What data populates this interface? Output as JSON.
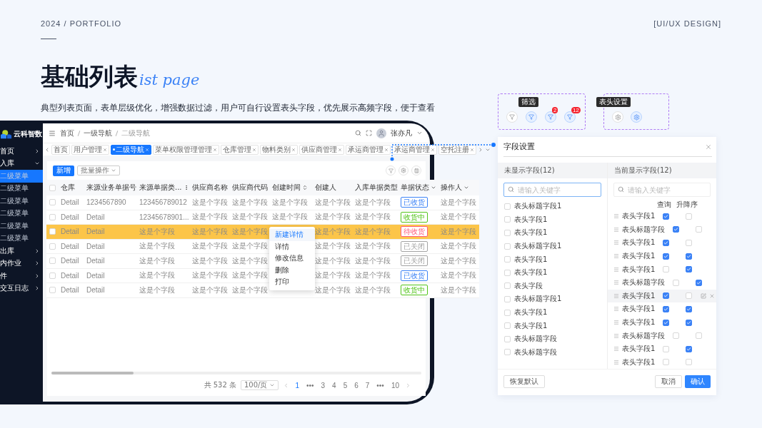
{
  "header": {
    "portfolio": "2024 / PORTFOLIO",
    "category": "[UI/UX DESIGN]"
  },
  "title": {
    "main": "基础列表",
    "script": "ist page"
  },
  "description": "典型列表页面，表单层级优化，增强数据过滤，用户可自行设置表头字段，优先展示高频字段，便于查看",
  "app": {
    "logo": "云科智数",
    "sidebar": [
      {
        "label": "首页",
        "expanded": false
      },
      {
        "label": "入库",
        "expanded": true,
        "children": [
          {
            "label": "二级菜单",
            "selected": true
          },
          {
            "label": "二级菜单",
            "selected": false
          },
          {
            "label": "二级菜单",
            "selected": false
          },
          {
            "label": "二级菜单",
            "selected": false
          },
          {
            "label": "二级菜单",
            "selected": false
          },
          {
            "label": "二级菜单",
            "selected": false
          }
        ]
      },
      {
        "label": "出库",
        "expanded": false
      },
      {
        "label": "内作业",
        "expanded": false
      },
      {
        "label": "件",
        "expanded": false
      },
      {
        "label": "交互日志",
        "expanded": false
      }
    ],
    "breadcrumb": [
      "首页",
      "一级导航",
      "二级导航"
    ],
    "user": {
      "name": "张亦凡"
    },
    "tabs": [
      {
        "label": "首页",
        "closable": false,
        "selected": false
      },
      {
        "label": "用户管理",
        "closable": true,
        "selected": false
      },
      {
        "label": "二级导航",
        "closable": true,
        "selected": true
      },
      {
        "label": "菜单权限管理管理",
        "closable": true,
        "selected": false
      },
      {
        "label": "仓库管理",
        "closable": true,
        "selected": false
      },
      {
        "label": "物料类别",
        "closable": true,
        "selected": false
      },
      {
        "label": "供应商管理",
        "closable": true,
        "selected": false
      },
      {
        "label": "承运商管理",
        "closable": true,
        "selected": false
      },
      {
        "label": "承运商管理",
        "closable": true,
        "selected": false
      },
      {
        "label": "空托注册",
        "closable": true,
        "selected": false
      }
    ],
    "toolbar": {
      "add": "新增",
      "batch": "批量操作"
    },
    "table": {
      "select_all_checked": false,
      "columns": [
        {
          "label": "仓库",
          "kind": "plain"
        },
        {
          "label": "来源业务单据号",
          "kind": "plain"
        },
        {
          "label": "来源单据类...",
          "kind": "menu"
        },
        {
          "label": "供应商名称",
          "kind": "plain"
        },
        {
          "label": "供应商代码",
          "kind": "plain"
        },
        {
          "label": "创建时间",
          "kind": "sort"
        },
        {
          "label": "创建人",
          "kind": "plain"
        },
        {
          "label": "入库单据类型",
          "kind": "plain"
        },
        {
          "label": "单据状态",
          "kind": "filter"
        },
        {
          "label": "操作人",
          "kind": "filter"
        }
      ],
      "rows": [
        {
          "checked": false,
          "highlighted": false,
          "cells": [
            "Detail",
            "1234567890",
            "123456789012",
            "这是个字段",
            "这是个字段",
            "这是个字段",
            "这是个字段",
            "这是个字段"
          ],
          "status": {
            "label": "已收货",
            "color": "#3b82f6"
          },
          "operator": "这是个字段"
        },
        {
          "checked": false,
          "highlighted": false,
          "cells": [
            "Detail",
            "Detail",
            "12345678901...",
            "这是个字段",
            "这是个字段",
            "这是个字段",
            "这是个字段",
            "这是个字段"
          ],
          "status": {
            "label": "收货中",
            "color": "#52c41a"
          },
          "operator": "这是个字段"
        },
        {
          "checked": false,
          "highlighted": true,
          "cells": [
            "Detail",
            "Detail",
            "这是个字段",
            "这是个字段",
            "这是个字段",
            null,
            "这是个字段",
            "这是个字段"
          ],
          "status": {
            "label": "待收货",
            "color": "#ff5c7a"
          },
          "operator": "这是个字段"
        },
        {
          "checked": false,
          "highlighted": false,
          "cells": [
            "Detail",
            "Detail",
            "这是个字段",
            "这是个字段",
            "这是个字段",
            null,
            "这是个字段",
            "这是个字段"
          ],
          "status": {
            "label": "已关闭",
            "color": "#a3a3a3"
          },
          "operator": "这是个字段"
        },
        {
          "checked": false,
          "highlighted": false,
          "cells": [
            "Detail",
            "Detail",
            "这是个字段",
            "这是个字段",
            "这是个字段",
            null,
            "这是个字段",
            "这是个字段"
          ],
          "status": {
            "label": "已关闭",
            "color": "#a3a3a3"
          },
          "operator": "这是个字段"
        },
        {
          "checked": false,
          "highlighted": false,
          "cells": [
            "Detail",
            "Detail",
            "这是个字段",
            "这是个字段",
            "这是个字段",
            null,
            "这是个字段",
            "这是个字段"
          ],
          "status": {
            "label": "已收货",
            "color": "#3b82f6"
          },
          "operator": "这是个字段"
        },
        {
          "checked": false,
          "highlighted": false,
          "cells": [
            "Detail",
            "Detail",
            "这是个字段",
            "这是个字段",
            "这是个字段",
            null,
            "这是个字段",
            "这是个字段"
          ],
          "status": {
            "label": "收货中",
            "color": "#52c41a"
          },
          "operator": "这是个字段"
        }
      ]
    },
    "context_menu": [
      {
        "label": "新建详情",
        "selected": true
      },
      {
        "label": "详情",
        "selected": false
      },
      {
        "label": "修改信息",
        "selected": false
      },
      {
        "label": "删除",
        "selected": false
      },
      {
        "label": "打印",
        "selected": false
      }
    ],
    "pagination": {
      "total": "共 532 条",
      "page_size": "100/页",
      "pages": [
        {
          "label": "1",
          "selected": true
        },
        {
          "label": "•••",
          "selected": false
        },
        {
          "label": "3",
          "selected": false
        },
        {
          "label": "4",
          "selected": false
        },
        {
          "label": "5",
          "selected": false
        },
        {
          "label": "6",
          "selected": false
        },
        {
          "label": "7",
          "selected": false
        },
        {
          "label": "•••",
          "selected": false
        },
        {
          "label": "10",
          "selected": false
        }
      ]
    }
  },
  "filter_demo": {
    "tooltip": "筛选",
    "buttons": [
      {
        "active": false
      },
      {
        "active": true
      },
      {
        "active": true,
        "badge": "2"
      },
      {
        "active": true,
        "badge": "12"
      }
    ]
  },
  "header_demo": {
    "tooltip": "表头设置",
    "buttons": [
      {
        "active": false
      },
      {
        "active": true
      }
    ]
  },
  "field_settings": {
    "title": "字段设置",
    "hidden": {
      "heading": "未显示字段(12)",
      "placeholder": "请输入关键字",
      "focused": true,
      "fields": [
        {
          "label": "表头标题字段1",
          "checked": false
        },
        {
          "label": "表头字段1",
          "checked": false
        },
        {
          "label": "表头字段1",
          "checked": false
        },
        {
          "label": "表头标题字段1",
          "checked": false
        },
        {
          "label": "表头字段1",
          "checked": false
        },
        {
          "label": "表头字段1",
          "checked": false
        },
        {
          "label": "表头字段",
          "checked": false
        },
        {
          "label": "表头标题字段1",
          "checked": false
        },
        {
          "label": "表头字段1",
          "checked": false
        },
        {
          "label": "表头字段1",
          "checked": false
        },
        {
          "label": "表头标题字段",
          "checked": false
        },
        {
          "label": "表头标题字段",
          "checked": false
        }
      ]
    },
    "shown": {
      "heading": "当前显示字段(12)",
      "placeholder": "请输入关键字",
      "focused": false,
      "columns": [
        "查询",
        "升降序"
      ],
      "fields": [
        {
          "label": "表头字段1",
          "query": true,
          "sort": false,
          "hovered": false
        },
        {
          "label": "表头标题字段",
          "query": true,
          "sort": false,
          "hovered": false
        },
        {
          "label": "表头字段1",
          "query": true,
          "sort": false,
          "hovered": false
        },
        {
          "label": "表头字段1",
          "query": true,
          "sort": true,
          "hovered": false
        },
        {
          "label": "表头字段1",
          "query": false,
          "sort": true,
          "hovered": false
        },
        {
          "label": "表头标题字段",
          "query": false,
          "sort": true,
          "hovered": false
        },
        {
          "label": "表头字段1",
          "query": true,
          "sort": false,
          "hovered": true
        },
        {
          "label": "表头字段1",
          "query": true,
          "sort": true,
          "hovered": false
        },
        {
          "label": "表头字段1",
          "query": true,
          "sort": true,
          "hovered": false
        },
        {
          "label": "表头标题字段",
          "query": false,
          "sort": false,
          "hovered": false
        },
        {
          "label": "表头字段1",
          "query": false,
          "sort": true,
          "hovered": false
        },
        {
          "label": "表头字段1",
          "query": false,
          "sort": false,
          "hovered": false
        }
      ]
    },
    "buttons": {
      "reset": "恢复默认",
      "cancel": "取消",
      "confirm": "确认"
    }
  }
}
